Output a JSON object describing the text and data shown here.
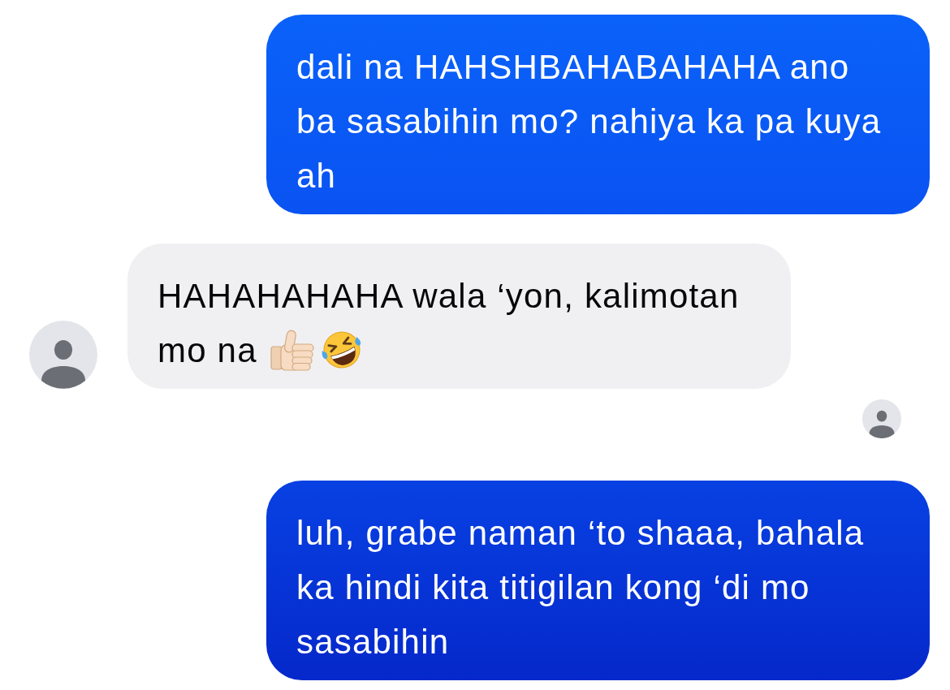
{
  "thread": [
    {
      "kind": "message",
      "outgoing": true,
      "text": "dali na HAHSHBAHABAHAHA ano ba sasabihin mo? nahiya ka pa kuya ah"
    },
    {
      "kind": "message",
      "outgoing": false,
      "text": "HAHAHAHAHA wala ‘yon, kalimotan mo na",
      "emoji": [
        {
          "kind": "thumbs-up"
        },
        {
          "kind": "laughing-face"
        }
      ]
    },
    {
      "kind": "read-receipt"
    },
    {
      "kind": "message",
      "outgoing": true,
      "text": "luh, grabe naman ‘to shaaa, bahala ka hindi kita titigilan kong ‘di mo sasabihin"
    }
  ]
}
